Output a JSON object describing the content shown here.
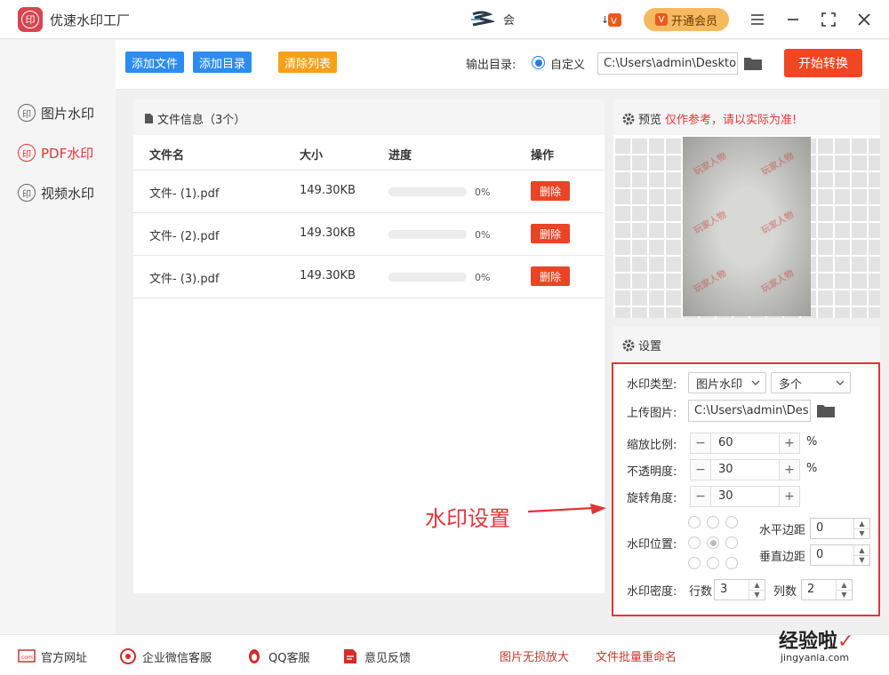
{
  "app": {
    "title": "优速水印工厂",
    "user_name": "会",
    "vip_label": "开通会员",
    "logo_char": "印"
  },
  "sidebar": {
    "items": [
      {
        "label": "图片水印",
        "icon": "印"
      },
      {
        "label": "PDF水印",
        "icon": "印"
      },
      {
        "label": "视频水印",
        "icon": "印"
      }
    ]
  },
  "toolbar": {
    "add_file": "添加文件",
    "add_dir": "添加目录",
    "clear_list": "清除列表",
    "output_label": "输出目录:",
    "radio_custom": "自定义",
    "output_path": "C:\\Users\\admin\\Deskto",
    "start": "开始转换",
    "colors": {
      "add": "#2d8cf0",
      "clear": "#f7a11a",
      "start": "#ef4723"
    }
  },
  "files": {
    "title": "文件信息（3个）",
    "columns": [
      "文件名",
      "大小",
      "进度",
      "操作"
    ],
    "rows": [
      {
        "name": "文件- (1).pdf",
        "size": "149.30KB",
        "progress": "0%",
        "action": "删除"
      },
      {
        "name": "文件- (2).pdf",
        "size": "149.30KB",
        "progress": "0%",
        "action": "删除"
      },
      {
        "name": "文件- (3).pdf",
        "size": "149.30KB",
        "progress": "0%",
        "action": "删除"
      }
    ]
  },
  "preview": {
    "title": "预览",
    "note": "仅作参考，请以实际为准!",
    "watermark_text": "玩家人物"
  },
  "settings": {
    "title": "设置",
    "type_label": "水印类型:",
    "type_value": "图片水印",
    "count_value": "多个",
    "upload_label": "上传图片:",
    "upload_path": "C:\\Users\\admin\\Des",
    "scale_label": "缩放比例:",
    "scale_value": "60",
    "opacity_label": "不透明度:",
    "opacity_value": "30",
    "rotate_label": "旋转角度:",
    "rotate_value": "30",
    "unit_percent": "%",
    "position_label": "水印位置:",
    "h_margin_label": "水平边距",
    "h_margin_value": "0",
    "v_margin_label": "垂直边距",
    "v_margin_value": "0",
    "density_label": "水印密度:",
    "rows_label": "行数",
    "rows_value": "3",
    "cols_label": "列数",
    "cols_value": "2"
  },
  "annotation": "水印设置",
  "footer": {
    "items": [
      "官方网址",
      "企业微信客服",
      "QQ客服",
      "意见反馈"
    ],
    "links": [
      "图片无损放大",
      "文件批量重命名"
    ],
    "brand": "经验啦",
    "brand_url": "jingyanla.com"
  }
}
